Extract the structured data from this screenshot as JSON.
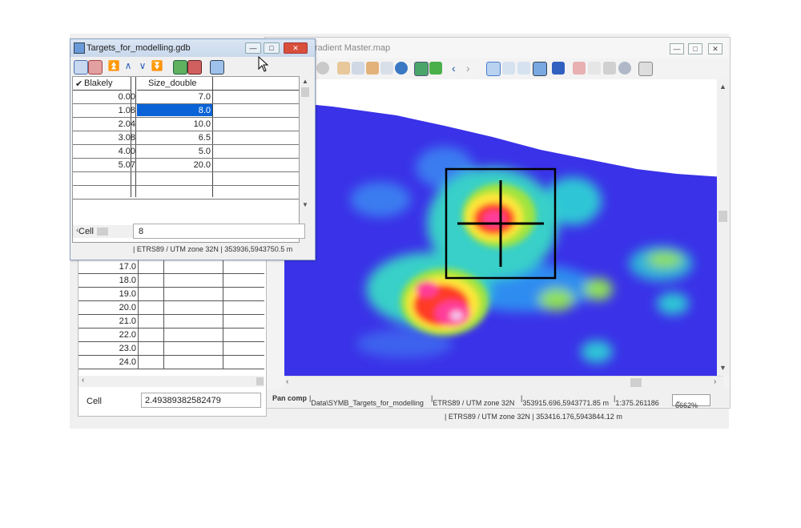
{
  "map_window": {
    "title": "radient Master.map",
    "status": {
      "tool": "Pan comp",
      "path": "Data\\SYMB_Targets_for_modelling",
      "crs": "ETRS89 / UTM zone 32N",
      "coords": "353915.696,5943771.85 m",
      "scale": "1:375.261186",
      "zoom": "6662%"
    }
  },
  "table_window": {
    "title": "Targets_for_modelling.gdb",
    "columns": [
      "Blakely",
      "Size_double"
    ],
    "rows": [
      {
        "blakely": "0.00",
        "size": "7.0"
      },
      {
        "blakely": "1.08",
        "size": "8.0"
      },
      {
        "blakely": "2.04",
        "size": "10.0"
      },
      {
        "blakely": "3.08",
        "size": "6.5"
      },
      {
        "blakely": "4.00",
        "size": "5.0"
      },
      {
        "blakely": "5.07",
        "size": "20.0"
      }
    ],
    "cell_label": "Cell",
    "cell_value": "8",
    "status": "| ETRS89 / UTM zone 32N | 353936,5943750.5 m"
  },
  "lower_table": {
    "values": [
      "17.0",
      "18.0",
      "19.0",
      "20.0",
      "21.0",
      "22.0",
      "23.0",
      "24.0"
    ],
    "cell_label": "Cell",
    "cell_value": "2.49389382582479"
  },
  "bottom_status": "| ETRS89 / UTM zone 32N | 353416.176,5943844.12 m",
  "colors": {
    "selection": "#0a63d6",
    "map_low": "#3a32e8",
    "map_high": "#ff2f8f"
  }
}
